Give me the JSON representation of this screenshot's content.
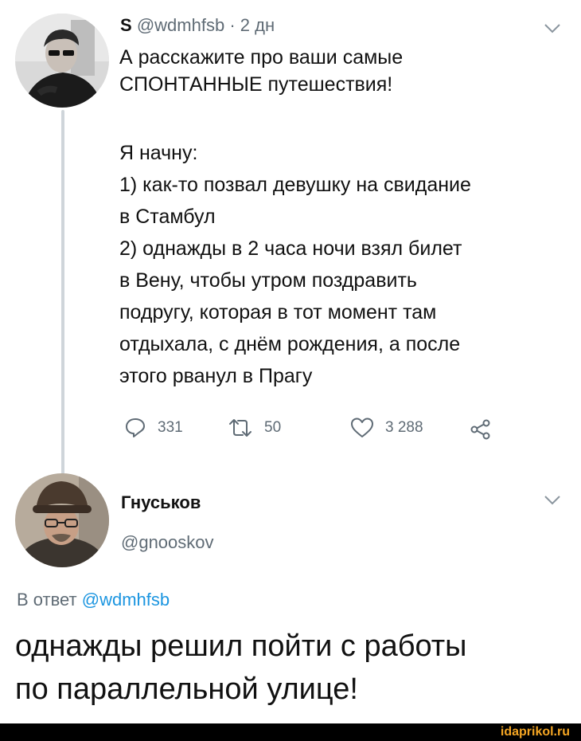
{
  "tweet": {
    "author_initial": "S",
    "handle": "@wdmhfsb",
    "separator": "·",
    "time": "2 дн",
    "text_lines": [
      "А расскажите про ваши самые",
      "СПОНТАННЫЕ путешествия!"
    ],
    "list_lines": [
      "Я начну:",
      "1) как-то позвал девушку на свидание",
      "в Стамбул",
      "2) однажды в 2 часа ночи взял билет",
      "в Вену, чтобы утром поздравить",
      "подругу, которая в тот момент там",
      "отдыхала, с днём рождения, а после",
      "этого рванул в Прагу"
    ],
    "actions": {
      "reply_count": "331",
      "retweet_count": "50",
      "like_count": "3 288"
    }
  },
  "reply": {
    "name": "Гнуськов",
    "handle": "@gnooskov",
    "in_reply_prefix": "В ответ",
    "in_reply_mention": "@wdmhfsb",
    "text_lines": [
      "однажды решил пойти с работы",
      "по параллельной улице!"
    ]
  },
  "footer": {
    "watermark": "idaprikol.ru"
  },
  "icons": {
    "chevron": "chevron-down-icon",
    "reply": "reply-icon",
    "retweet": "retweet-icon",
    "like": "heart-icon",
    "share": "share-icon"
  },
  "colors": {
    "secondary_text": "#5f6b75",
    "mention": "#1b95e0",
    "thread_line": "#cfd5da",
    "watermark": "#f5a623"
  }
}
